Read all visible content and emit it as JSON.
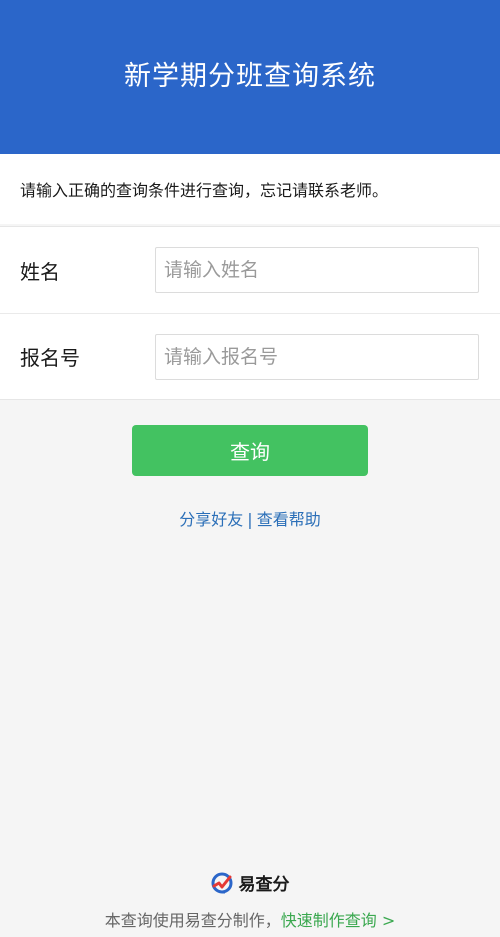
{
  "header": {
    "title": "新学期分班查询系统"
  },
  "notice": {
    "text": "请输入正确的查询条件进行查询，忘记请联系老师。"
  },
  "form": {
    "fields": [
      {
        "label": "姓名",
        "placeholder": "请输入姓名",
        "value": ""
      },
      {
        "label": "报名号",
        "placeholder": "请输入报名号",
        "value": ""
      }
    ],
    "submit_label": "查询"
  },
  "links": {
    "share": "分享好友",
    "separator": "|",
    "help": "查看帮助"
  },
  "footer": {
    "brand": "易查分",
    "powered_text": "本查询使用易查分制作，",
    "quick_link": "快速制作查询 >"
  },
  "colors": {
    "header_bg": "#2b66c9",
    "button_bg": "#43c261",
    "link": "#2b6fb8",
    "footer_link": "#3aa84f"
  },
  "icons": {
    "brand": "yichafen-logo-icon"
  }
}
